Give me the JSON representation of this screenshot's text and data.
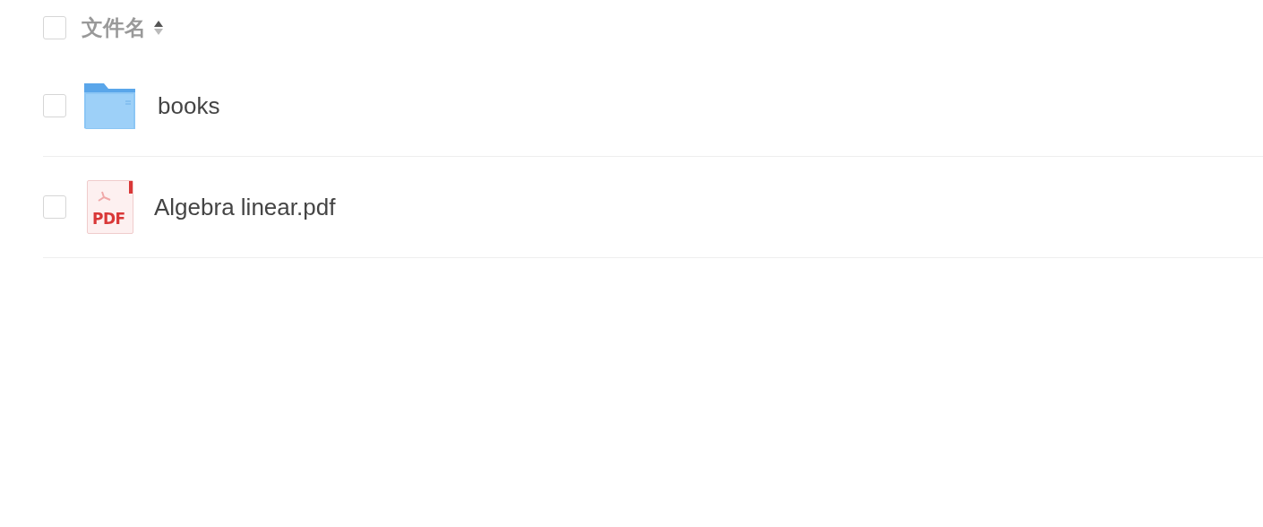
{
  "header": {
    "checked": false,
    "label": "文件名",
    "sort_ascending": true
  },
  "files": [
    {
      "kind": "folder",
      "name": "books",
      "checked": false
    },
    {
      "kind": "pdf",
      "name": "Algebra linear.pdf",
      "checked": false,
      "badge": "PDF"
    }
  ]
}
